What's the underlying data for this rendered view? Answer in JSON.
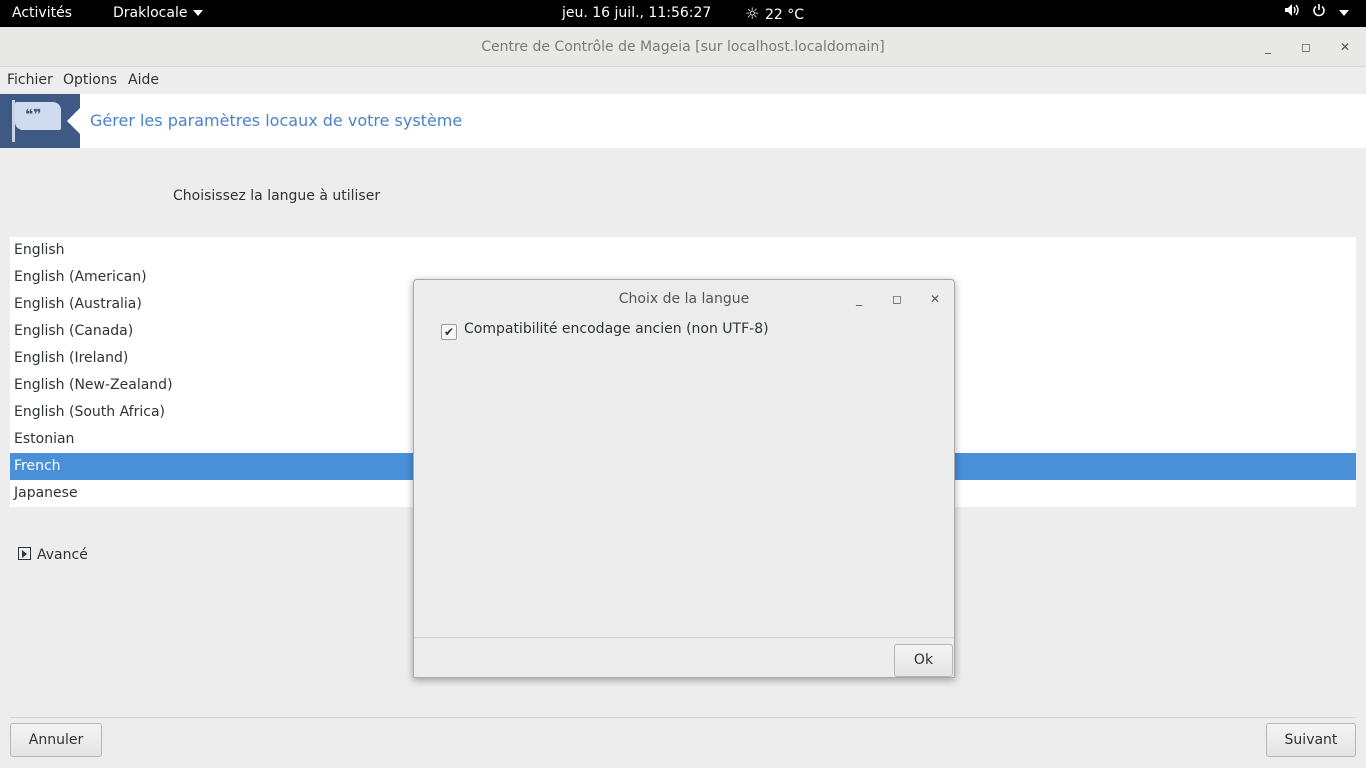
{
  "topbar": {
    "activities": "Activités",
    "app_menu": "Draklocale",
    "clock": "jeu. 16 juil., 11:56:27",
    "weather": "22 °C",
    "icons": [
      "sun-icon",
      "volume-icon",
      "power-icon",
      "chevron-down-icon"
    ]
  },
  "window": {
    "title": "Centre de Contrôle de Mageia  [sur localhost.localdomain]",
    "min": "_",
    "max": "◻",
    "close": "✕"
  },
  "menubar": {
    "fichier": "Fichier",
    "options": "Options",
    "aide": "Aide"
  },
  "banner": {
    "title": "Gérer les paramètres locaux de votre système"
  },
  "main": {
    "choose_label": "Choisissez la langue à utiliser",
    "languages": [
      "English",
      "English (American)",
      "English (Australia)",
      "English (Canada)",
      "English (Ireland)",
      "English (New-Zealand)",
      "English (South Africa)",
      "Estonian",
      "French",
      "Japanese"
    ],
    "selected_language": "French",
    "advanced": "Avancé"
  },
  "footer": {
    "cancel": "Annuler",
    "next": "Suivant"
  },
  "dialog": {
    "title": "Choix de la langue",
    "min": "_",
    "max": "◻",
    "close": "✕",
    "checkbox_label": "Compatibilité encodage ancien (non UTF-8)",
    "checkbox_checked": true,
    "ok": "Ok"
  },
  "colors": {
    "selection": "#4a90d9",
    "banner_title": "#4a82c9",
    "banner_logo": "#3e5a84"
  }
}
